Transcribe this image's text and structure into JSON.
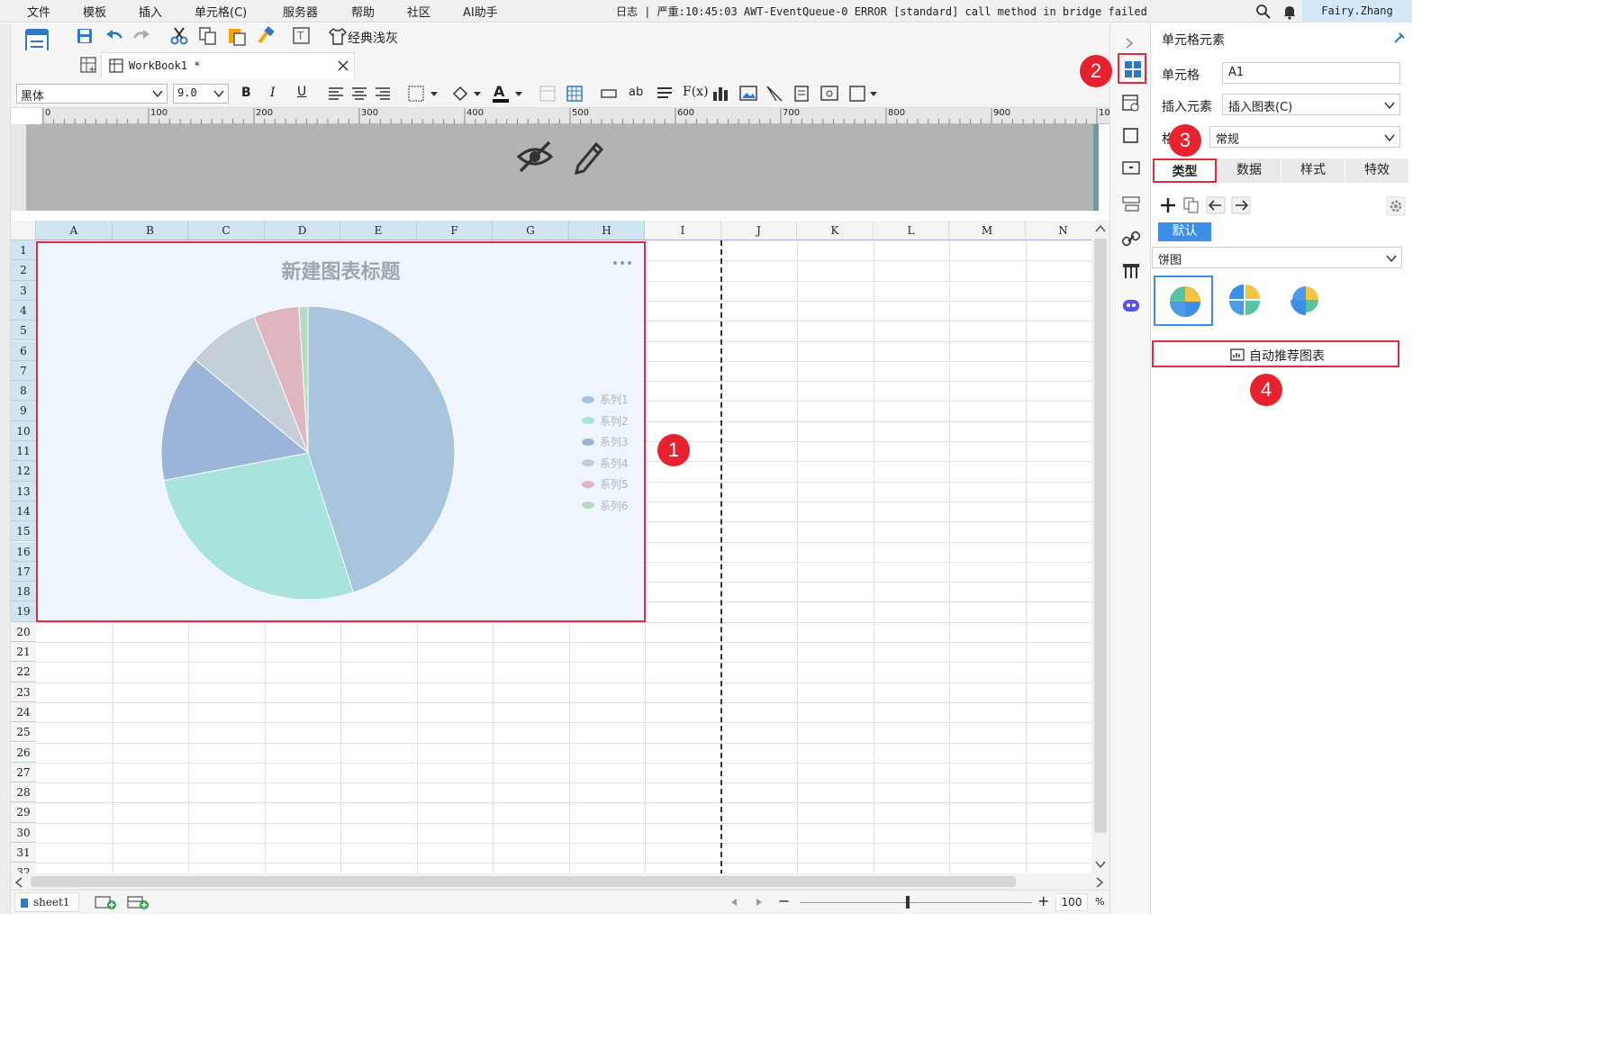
{
  "menu": [
    "文件",
    "模板",
    "插入",
    "单元格(C)",
    "服务器",
    "帮助",
    "社区",
    "AI助手"
  ],
  "log_text": "日志 | 严重:10:45:03 AWT-EventQueue-0 ERROR [standard] call method in bridge failed",
  "user": "Fairy.Zhang",
  "toolbar": {
    "theme_label": "经典浅灰"
  },
  "workbook_tab": "WorkBook1 *",
  "format": {
    "font": "黑体",
    "size": "9.0"
  },
  "ruler_ticks": [
    "0",
    "100",
    "200",
    "300",
    "400",
    "500",
    "600",
    "700",
    "800",
    "900",
    "10"
  ],
  "columns": [
    "A",
    "B",
    "C",
    "D",
    "E",
    "F",
    "G",
    "H",
    "I",
    "J",
    "K",
    "L",
    "M",
    "N"
  ],
  "rows": [
    "1",
    "2",
    "3",
    "4",
    "5",
    "6",
    "7",
    "8",
    "9",
    "10",
    "11",
    "12",
    "13",
    "14",
    "15",
    "16",
    "17",
    "18",
    "19",
    "20",
    "21",
    "22",
    "23",
    "24",
    "25",
    "26",
    "27",
    "28",
    "29",
    "30",
    "31",
    "32"
  ],
  "chart_data": {
    "type": "pie",
    "title": "新建图表标题",
    "legend_position": "right",
    "series": [
      {
        "name": "系列1",
        "value": 45,
        "color": "#a9c5de"
      },
      {
        "name": "系列2",
        "value": 27,
        "color": "#a8e3de"
      },
      {
        "name": "系列3",
        "value": 14,
        "color": "#9bb5da"
      },
      {
        "name": "系列4",
        "value": 8,
        "color": "#c4cfd8"
      },
      {
        "name": "系列5",
        "value": 5,
        "color": "#dfb6c0"
      },
      {
        "name": "系列6",
        "value": 1,
        "color": "#b8dbc4"
      }
    ]
  },
  "sheet_tab": "sheet1",
  "zoom": "100",
  "zoom_pct": "%",
  "panel": {
    "title": "单元格元素",
    "cell_label": "单元格",
    "cell_value": "A1",
    "insert_label": "插入元素",
    "insert_value": "插入图表(C)",
    "format_label": "格",
    "format_value": "常规",
    "tabs": [
      "类型",
      "数据",
      "样式",
      "特效"
    ],
    "default_badge": "默认",
    "chart_type": "饼图",
    "recommend_label": "自动推荐图表"
  },
  "markers": [
    "1",
    "2",
    "3",
    "4"
  ],
  "colors": {
    "accent": "#e02c3c",
    "header_blue": "#cfe6f2",
    "badge_blue": "#3d8ee6"
  }
}
